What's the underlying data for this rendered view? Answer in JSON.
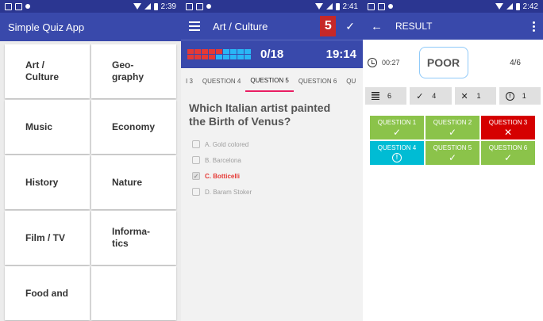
{
  "screen1": {
    "status_time": "2:39",
    "title": "Simple Quiz App",
    "categories": [
      "Art /\nCulture",
      "Geo-\ngraphy",
      "Music",
      "Economy",
      "History",
      "Nature",
      "Film / TV",
      "Informa-\ntics",
      "Food and",
      ""
    ]
  },
  "screen2": {
    "status_time": "2:41",
    "title": "Art / Culture",
    "badge": "5",
    "check_icon": "✓",
    "progress": "0/18",
    "timer": "19:14",
    "mini_cells": [
      "#e53935",
      "#e53935",
      "#e53935",
      "#e53935",
      "#e53935",
      "#29b6f6",
      "#29b6f6",
      "#29b6f6",
      "#29b6f6",
      "#e53935",
      "#e53935",
      "#e53935",
      "#e53935",
      "#29b6f6",
      "#29b6f6",
      "#29b6f6",
      "#29b6f6",
      "#29b6f6"
    ],
    "tabs": [
      "I 3",
      "QUESTION 4",
      "QUESTION 5",
      "QUESTION 6",
      "QU"
    ],
    "active_tab_index": 2,
    "question": "Which Italian artist painted the Birth of Venus?",
    "answers": [
      {
        "label": "A. Gold colored",
        "selected": false
      },
      {
        "label": "B. Barcelona",
        "selected": false
      },
      {
        "label": "C. Botticelli",
        "selected": true
      },
      {
        "label": "D. Baram Stoker",
        "selected": false
      }
    ]
  },
  "screen3": {
    "status_time": "2:42",
    "title": "RESULT",
    "back_icon": "←",
    "elapsed": "00:27",
    "grade": "POOR",
    "score": "4/6",
    "stats": {
      "total": "6",
      "correct": "4",
      "wrong": "1",
      "skipped": "1"
    },
    "stat_icons": {
      "correct": "✓",
      "wrong": "✕",
      "skipped": "!"
    },
    "questions": [
      {
        "label": "QUESTION 1",
        "status": "correct",
        "color": "#8bc34a"
      },
      {
        "label": "QUESTION 2",
        "status": "correct",
        "color": "#8bc34a"
      },
      {
        "label": "QUESTION 3",
        "status": "wrong",
        "color": "#d50000"
      },
      {
        "label": "QUESTION 4",
        "status": "skipped",
        "color": "#00bcd4"
      },
      {
        "label": "QUESTION 5",
        "status": "correct",
        "color": "#8bc34a"
      },
      {
        "label": "QUESTION 6",
        "status": "correct",
        "color": "#8bc34a"
      }
    ]
  }
}
